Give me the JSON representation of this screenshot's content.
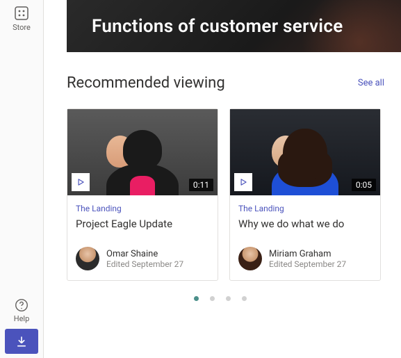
{
  "rail": {
    "store": "Store",
    "help": "Help"
  },
  "hero": {
    "title": "Functions of customer service"
  },
  "section": {
    "title": "Recommended viewing",
    "see_all": "See all"
  },
  "cards": [
    {
      "site": "The Landing",
      "title": "Project Eagle Update",
      "duration": "0:11",
      "author": "Omar Shaine",
      "edited": "Edited September 27"
    },
    {
      "site": "The Landing",
      "title": "Why we do what we do",
      "duration": "0:05",
      "author": "Miriam Graham",
      "edited": "Edited September 27"
    }
  ],
  "pagination": {
    "count": 4,
    "active": 0
  }
}
